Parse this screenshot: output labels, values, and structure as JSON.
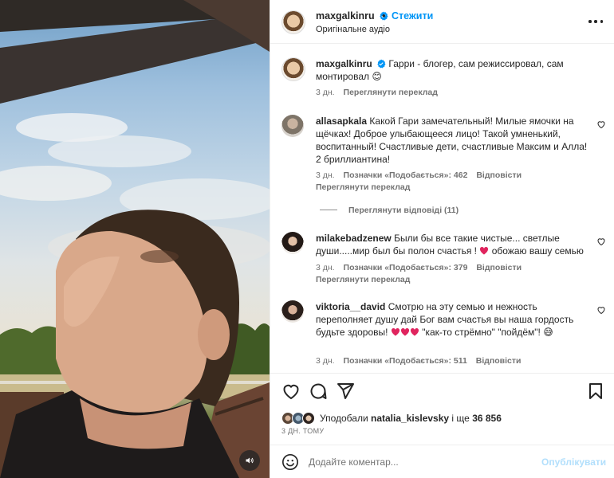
{
  "post": {
    "username": "maxgalkinru",
    "follow_label": "Стежити",
    "audio_label": "Оригінальне аудіо",
    "separator": "•"
  },
  "caption": {
    "username": "maxgalkinru",
    "text": "Гарри - блогер, сам режиссировал, сам монтировал",
    "emoji": "😊",
    "time": "3 дн.",
    "translate": "Переглянути переклад"
  },
  "comments": [
    {
      "username": "allasapkala",
      "text": "Какой Гари замечательный! Милые ямочки на щёчках! Доброе улыбающееся лицо! Такой умненький, воспитанный! Счастливые дети, счастливые Максим и Алла! 2 бриллиантина!",
      "time": "3 дн.",
      "likes": "Позначки «Подобається»: 462",
      "reply": "Відповісти",
      "translate": "Переглянути переклад",
      "view_replies": "Переглянути відповіді (11)"
    },
    {
      "username": "milakebadzenew",
      "text_a": "Были бы все такие чистые... светлые души.....мир был бы полон счастья !",
      "text_b": "обожаю вашу семью",
      "time": "3 дн.",
      "likes": "Позначки «Подобається»: 379",
      "reply": "Відповісти",
      "translate": "Переглянути переклад"
    },
    {
      "username": "viktoria__david",
      "text_a": "Смотрю на эту семью и нежность переполняет душу дай Бог вам счастья вы наша гордость будьте здоровы!",
      "text_b": "\"как-то стрёмно\" \"пойдём\"!",
      "emoji": "😅",
      "time": "3 дн.",
      "likes": "Позначки «Подобається»: 511",
      "reply": "Відповісти"
    }
  ],
  "likes": {
    "prefix": "Уподобали",
    "user": "natalia_kislevsky",
    "middle": "і ще",
    "count": "36 856",
    "time_ago": "3 ДН. ТОМУ"
  },
  "compose": {
    "placeholder": "Додайте коментар...",
    "publish": "Опублікувати"
  },
  "colors": {
    "accent": "#0095f6",
    "heart": "#ed4956",
    "publish_disabled": "#b2dffc"
  },
  "icons": [
    "volume-icon",
    "verified-icon",
    "more-icon",
    "heart-icon",
    "comment-icon",
    "share-icon",
    "bookmark-icon",
    "emoji-icon"
  ]
}
